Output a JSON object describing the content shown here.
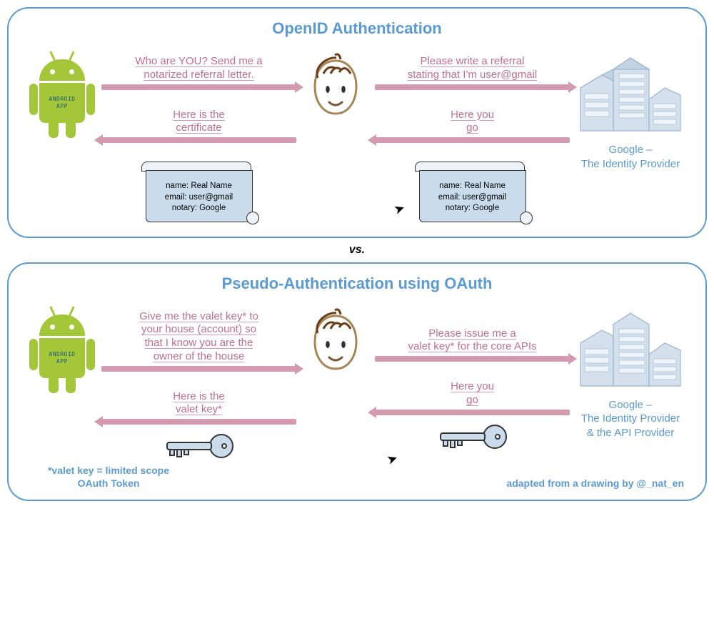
{
  "vs_label": "vs.",
  "android_label": "anDroiD\napp",
  "panel_top": {
    "title": "OpenID Authentication",
    "arrow_app_to_user": "Who are YOU? Send me a\nnotarized referral letter.",
    "arrow_user_to_idp": "Please write a referral\nstating that I'm user@gmail",
    "arrow_idp_to_user": "Here you\ngo",
    "arrow_user_to_app": "Here is the\ncertificate",
    "certificate": {
      "line1": "name: Real Name",
      "line2": "email: user@gmail",
      "line3": "notary: Google"
    },
    "idp_label": "Google –\nThe Identity Provider"
  },
  "panel_bottom": {
    "title": "Pseudo-Authentication using OAuth",
    "arrow_app_to_user": "Give me the valet key* to\nyour house (account) so\nthat I know you are the\nowner of the house",
    "arrow_user_to_idp": "Please issue me a\nvalet key* for the core APIs",
    "arrow_idp_to_user": "Here you\ngo",
    "arrow_user_to_app": "Here is the\nvalet key*",
    "idp_label": "Google –\nThe Identity Provider\n& the API Provider",
    "footnote_left": "*valet key = limited scope\nOAuth Token",
    "footnote_right": "adapted from a drawing by @_nat_en"
  }
}
